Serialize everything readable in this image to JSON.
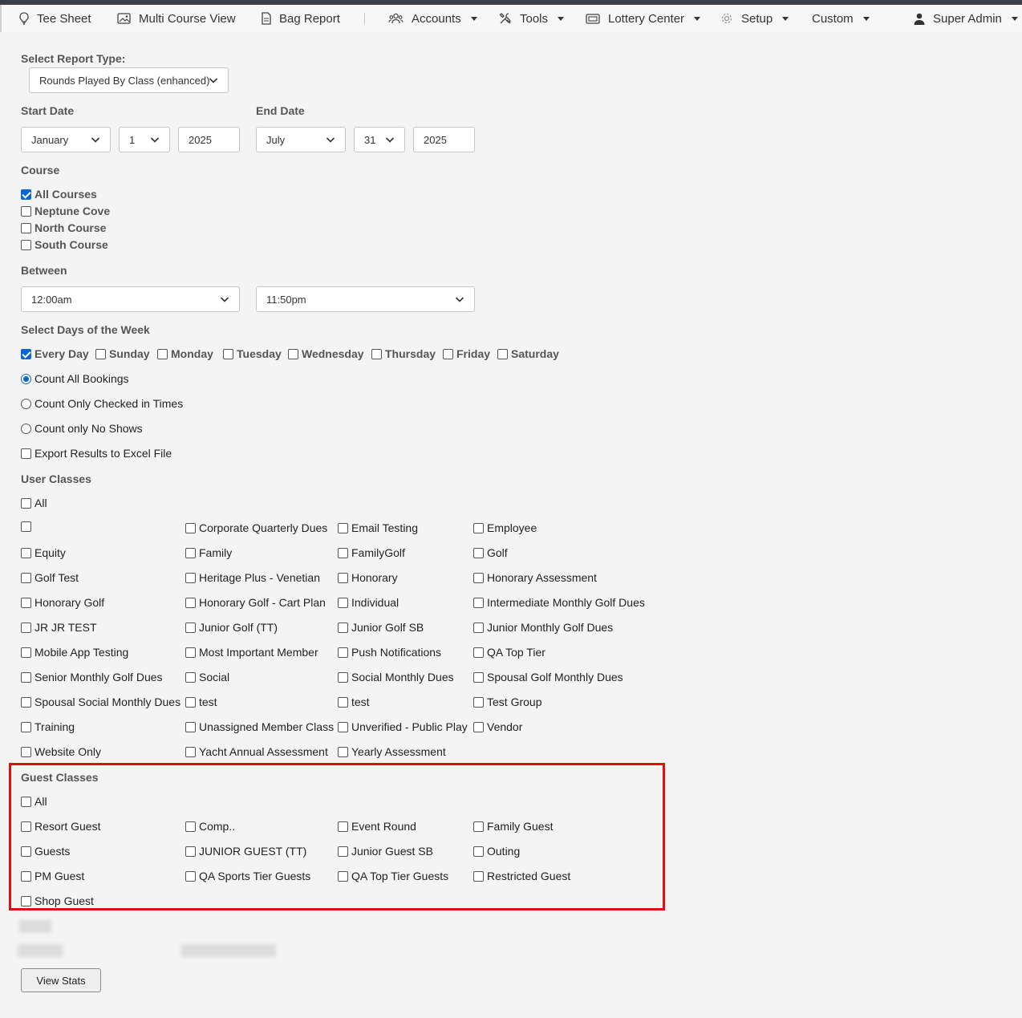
{
  "nav": {
    "tee_sheet": "Tee Sheet",
    "multi_course_view": "Multi Course View",
    "bag_report": "Bag Report",
    "accounts": "Accounts",
    "tools": "Tools",
    "lottery_center": "Lottery Center",
    "setup": "Setup",
    "custom": "Custom",
    "user": "Super Admin"
  },
  "report": {
    "type_label": "Select Report Type:",
    "type_value": "Rounds Played By Class (enhanced)"
  },
  "dates": {
    "start_label": "Start Date",
    "start_month": "January",
    "start_day": "1",
    "start_year": "2025",
    "end_label": "End Date",
    "end_month": "July",
    "end_day": "31",
    "end_year": "2025"
  },
  "course": {
    "label": "Course",
    "options": [
      {
        "label": "All Courses",
        "checked": true
      },
      {
        "label": "Neptune Cove",
        "checked": false
      },
      {
        "label": "North Course",
        "checked": false
      },
      {
        "label": "South Course",
        "checked": false
      }
    ]
  },
  "between": {
    "label": "Between",
    "from": "12:00am",
    "to": "11:50pm"
  },
  "days": {
    "label": "Select Days of the Week",
    "options": [
      {
        "label": "Every Day",
        "checked": true
      },
      {
        "label": "Sunday",
        "checked": false
      },
      {
        "label": "Monday",
        "checked": false
      },
      {
        "label": "Tuesday",
        "checked": false
      },
      {
        "label": "Wednesday",
        "checked": false
      },
      {
        "label": "Thursday",
        "checked": false
      },
      {
        "label": "Friday",
        "checked": false
      },
      {
        "label": "Saturday",
        "checked": false
      }
    ]
  },
  "count": {
    "options": [
      {
        "label": "Count All Bookings",
        "checked": true
      },
      {
        "label": "Count Only Checked in Times",
        "checked": false
      },
      {
        "label": "Count only No Shows",
        "checked": false
      }
    ],
    "export_label": "Export Results to Excel File"
  },
  "user_classes": {
    "label": "User Classes",
    "all_label": "All",
    "items": [
      "",
      "Corporate Quarterly Dues",
      "Email Testing",
      "Employee",
      "Equity",
      "Family",
      "FamilyGolf",
      "Golf",
      "Golf Test",
      "Heritage Plus - Venetian",
      "Honorary",
      "Honorary Assessment",
      "Honorary Golf",
      "Honorary Golf - Cart Plan",
      "Individual",
      "Intermediate Monthly Golf Dues",
      "JR JR TEST",
      "Junior Golf (TT)",
      "Junior Golf SB",
      "Junior Monthly Golf Dues",
      "Mobile App Testing",
      "Most Important Member",
      "Push Notifications",
      "QA Top Tier",
      "Senior Monthly Golf Dues",
      "Social",
      "Social Monthly Dues",
      "Spousal Golf Monthly Dues",
      "Spousal Social Monthly Dues",
      "test",
      "test",
      "Test Group",
      "Training",
      "Unassigned Member Class",
      "Unverified - Public Play",
      "Vendor",
      "Website Only",
      "Yacht Annual Assessment",
      "Yearly Assessment"
    ]
  },
  "guest_classes": {
    "label": "Guest Classes",
    "all_label": "All",
    "items": [
      "Resort Guest",
      "Comp..",
      "Event Round",
      "Family Guest",
      "Guests",
      "JUNIOR GUEST (TT)",
      "Junior Guest SB",
      "Outing",
      "PM Guest",
      "QA Sports Tier Guests",
      "QA Top Tier Guests",
      "Restricted Guest",
      "Shop Guest"
    ]
  },
  "actions": {
    "view_stats": "View Stats"
  },
  "colors": {
    "accent": "#0a66d6",
    "highlight": "#e01010"
  }
}
